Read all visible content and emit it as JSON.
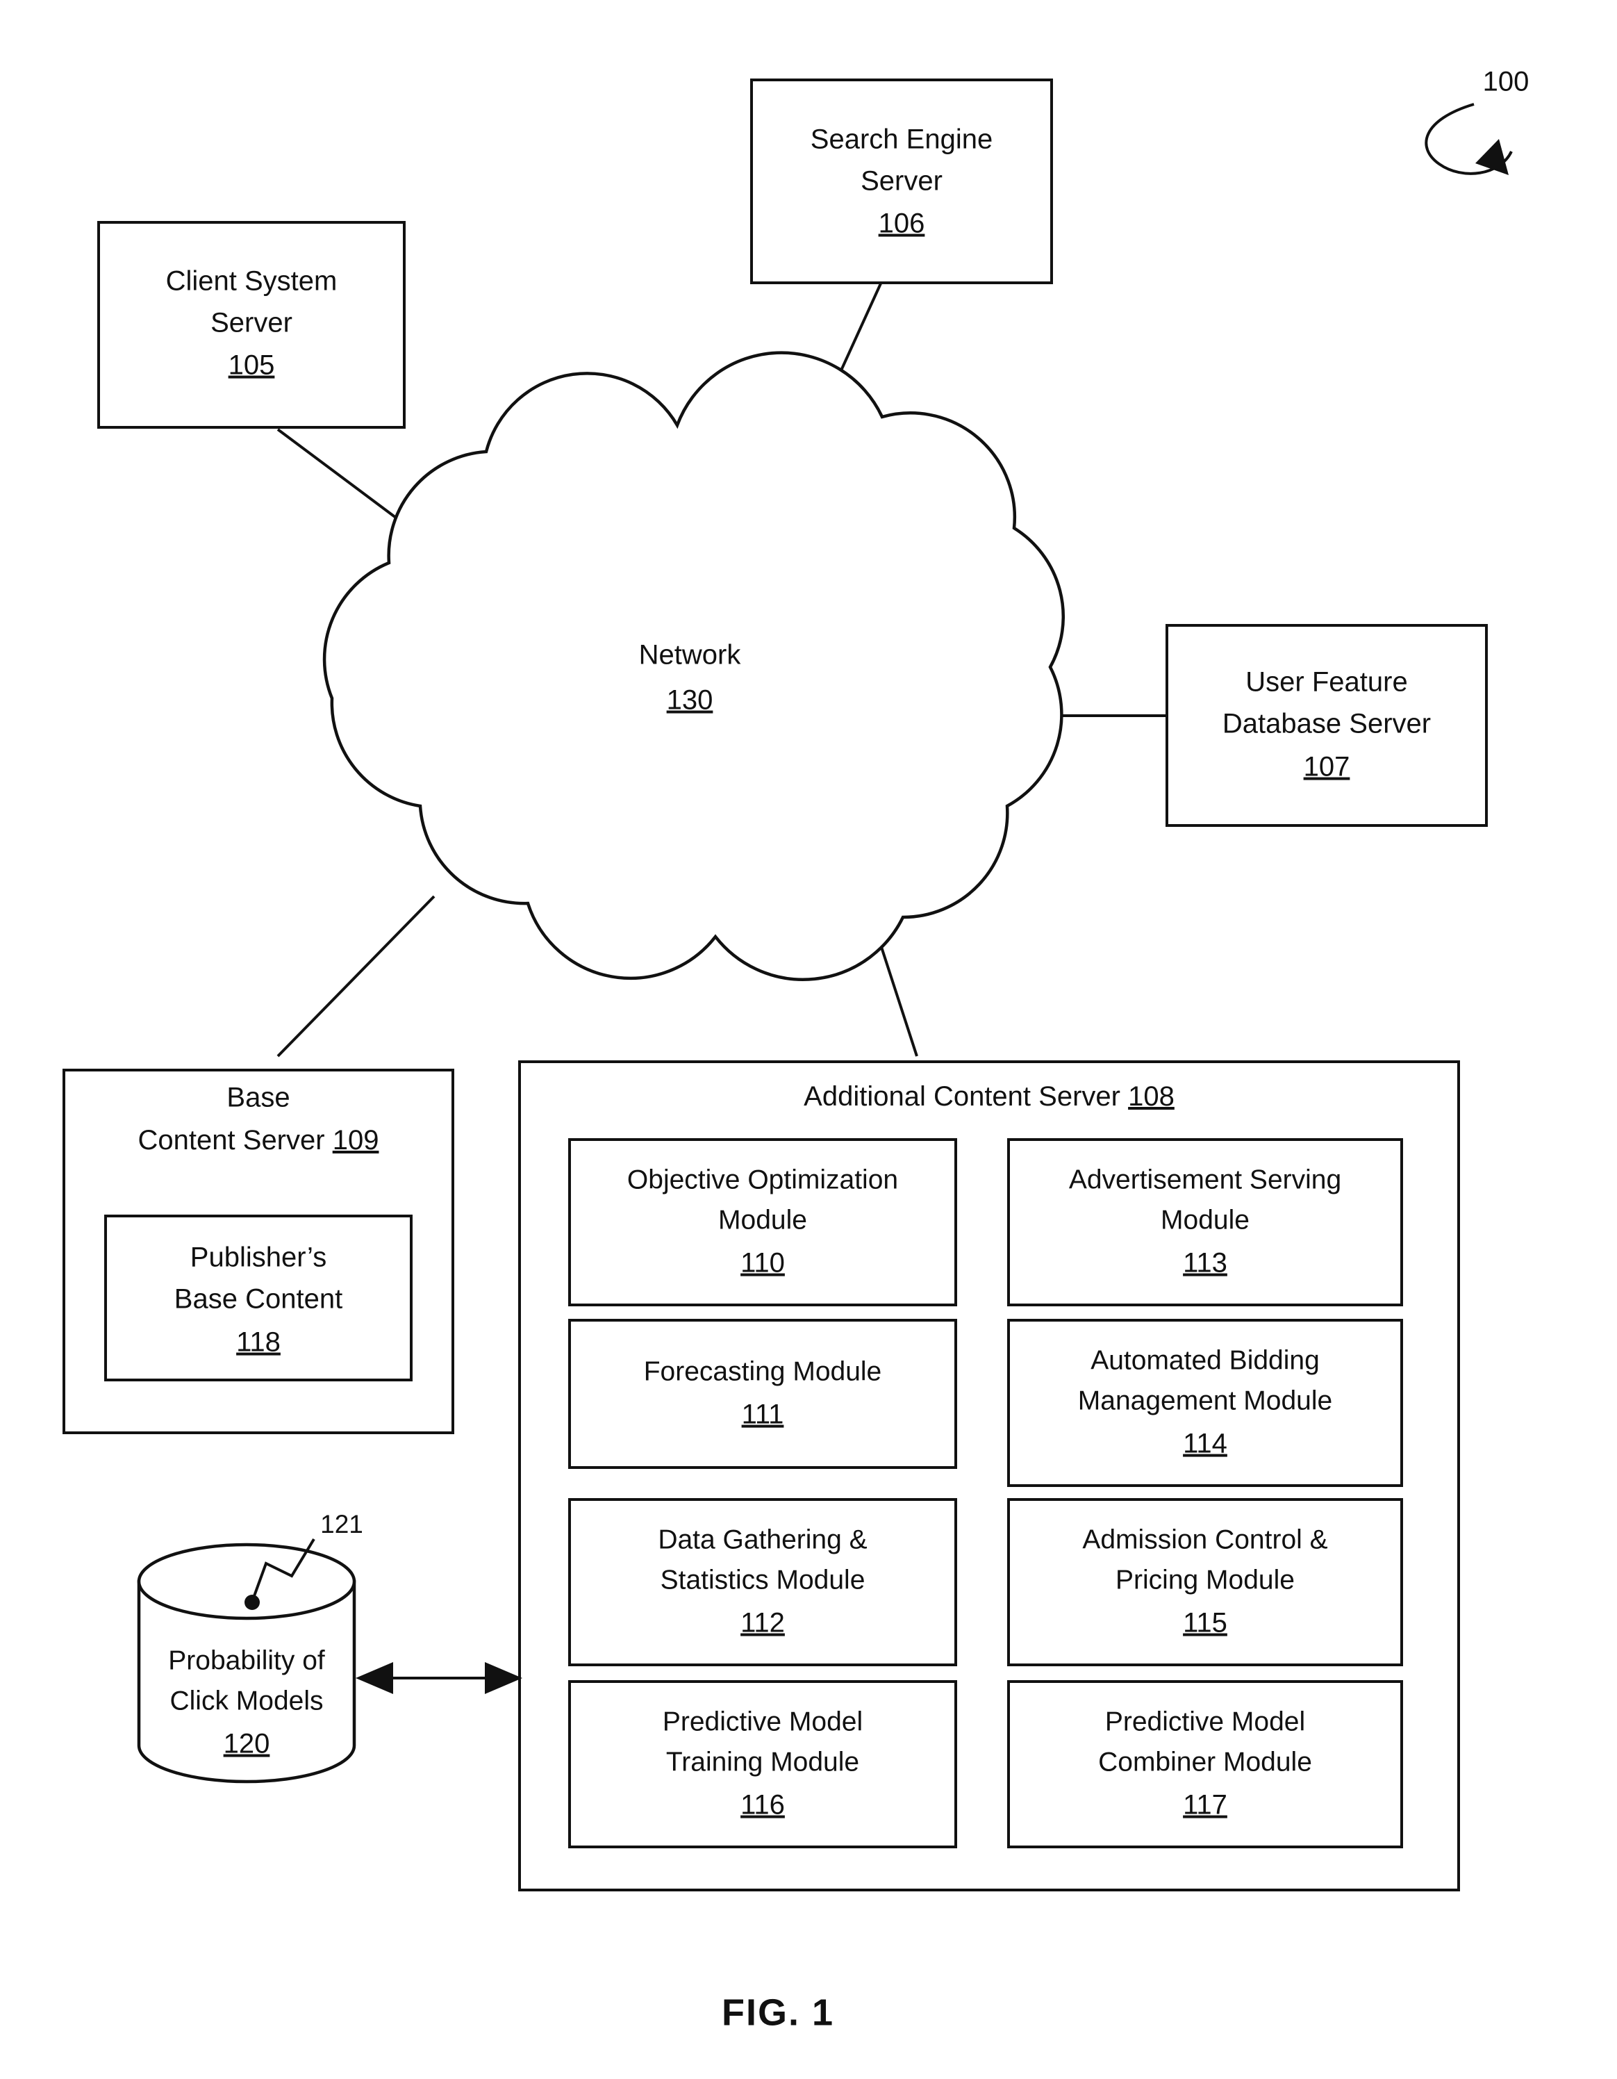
{
  "figure": {
    "caption": "FIG. 1",
    "system_reference": "100"
  },
  "nodes": {
    "client_system_server": {
      "line1": "Client System",
      "line2": "Server",
      "ref": "105"
    },
    "search_engine_server": {
      "line1": "Search Engine",
      "line2": "Server",
      "ref": "106"
    },
    "user_feature_database_server": {
      "line1": "User Feature",
      "line2": "Database Server",
      "ref": "107"
    },
    "network": {
      "label": "Network",
      "ref": "130"
    },
    "base_content_server": {
      "line1": "Base",
      "line2": "Content Server",
      "ref": "109",
      "inner": {
        "line1": "Publisher’s",
        "line2": "Base Content",
        "ref": "118"
      }
    },
    "probability_of_click_models": {
      "line1": "Probability of",
      "line2": "Click Models",
      "ref": "120",
      "callout_ref": "121"
    },
    "additional_content_server": {
      "title": "Additional Content Server",
      "ref": "108",
      "modules_left": [
        {
          "line1": "Objective Optimization",
          "line2": "Module",
          "ref": "110"
        },
        {
          "line1": "Forecasting Module",
          "line2": "",
          "ref": "111"
        },
        {
          "line1": "Data Gathering &",
          "line2": "Statistics Module",
          "ref": "112"
        },
        {
          "line1": "Predictive Model",
          "line2": "Training Module",
          "ref": "116"
        }
      ],
      "modules_right": [
        {
          "line1": "Advertisement Serving",
          "line2": "Module",
          "ref": "113"
        },
        {
          "line1": "Automated Bidding",
          "line2": "Management Module",
          "ref": "114"
        },
        {
          "line1": "Admission Control &",
          "line2": "Pricing Module",
          "ref": "115"
        },
        {
          "line1": "Predictive Model",
          "line2": "Combiner Module",
          "ref": "117"
        }
      ]
    }
  },
  "colors": {
    "ink": "#111111",
    "paper": "#ffffff"
  }
}
